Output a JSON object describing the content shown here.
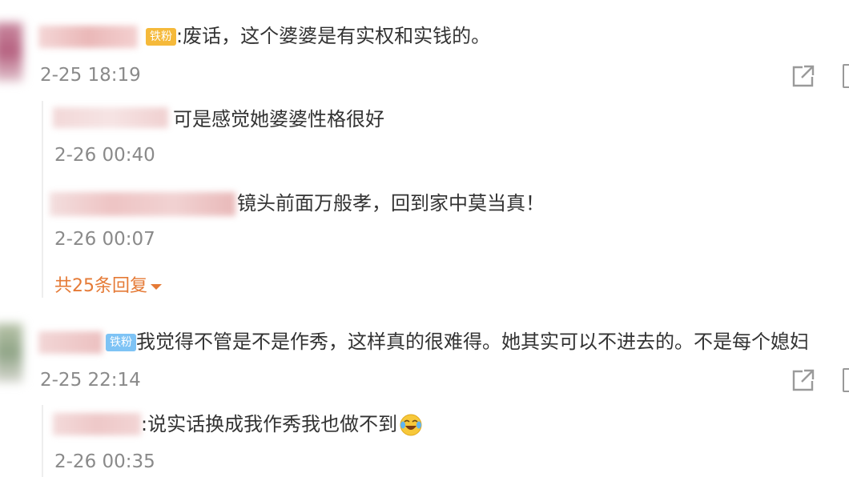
{
  "comments": [
    {
      "badge": "铁粉",
      "text": ":废话，这个婆婆是有实权和实钱的。",
      "time": "2-25 18:19",
      "replies": [
        {
          "text": "可是感觉她婆婆性格很好",
          "time": "2-26 00:40"
        },
        {
          "text": "镜头前面万般孝，回到家中莫当真！",
          "time": "2-26 00:07"
        }
      ],
      "more_replies": "共25条回复"
    },
    {
      "badge": "铁粉",
      "text": "我觉得不管是不是作秀，这样真的很难得。她其实可以不进去的。不是每个媳妇",
      "time": "2-25 22:14",
      "replies": [
        {
          "text": ":说实话换成我作秀我也做不到",
          "time": "2-26 00:35"
        }
      ]
    }
  ],
  "colors": {
    "time": "#8a8a8a",
    "more_link": "#e57a36",
    "badge_gold": "#f5b93a",
    "badge_blue": "#7ec3f5"
  },
  "icons": [
    "share-icon",
    "more-icon",
    "laughing-crying-emoji"
  ]
}
